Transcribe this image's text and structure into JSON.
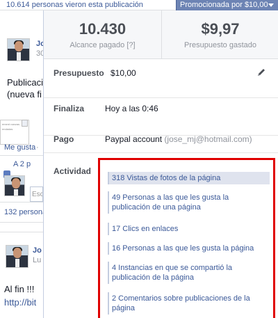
{
  "topbar": {
    "views_text": "10.614 personas vieron esta publicación",
    "promoted_label": "Promocionada por $10,00"
  },
  "background_feed": {
    "post1_author": "Jo",
    "post1_time": "30",
    "post1_text_line1": "Publicaci",
    "post1_text_line2": "(nueva fi",
    "thumb_text": "ement nanzas endadas",
    "like_link": "Me gusta",
    "like_dot": "·",
    "likes_count": "A 2 p",
    "comment_placeholder": "Esc",
    "shares_text": "132 persona",
    "post2_author": "Jo",
    "post2_time": "Lu",
    "post2_text_line1": "Al fin !!!",
    "post2_text_line2": "http://bit"
  },
  "stats": {
    "paid_reach_value": "10.430",
    "paid_reach_label": "Alcance pagado",
    "paid_reach_help": "[?]",
    "budget_spent_value": "$9,97",
    "budget_spent_label": "Presupuesto gastado"
  },
  "details": {
    "budget_label": "Presupuesto",
    "budget_value": "$10,00",
    "ends_label": "Finaliza",
    "ends_value": "Hoy a las 0:46",
    "payment_label": "Pago",
    "payment_value": "Paypal account",
    "payment_email": "(jose_mj@hotmail.com)",
    "activity_label": "Actividad"
  },
  "activity": [
    "318 Vistas de fotos de la página",
    "49 Personas a las que les gusta la publicación de una página",
    "17 Clics en enlaces",
    "16 Personas a las que les gusta la página",
    "4 Instancias en que se compartió la publicación de la página",
    "2 Comentarios sobre publicaciones de la página"
  ],
  "icons": {
    "edit": "pencil-icon",
    "dropdown": "caret-down-icon"
  },
  "colors": {
    "link": "#3b5998",
    "highlight_border": "#e00000",
    "promo_bg": "#6d84b4"
  }
}
